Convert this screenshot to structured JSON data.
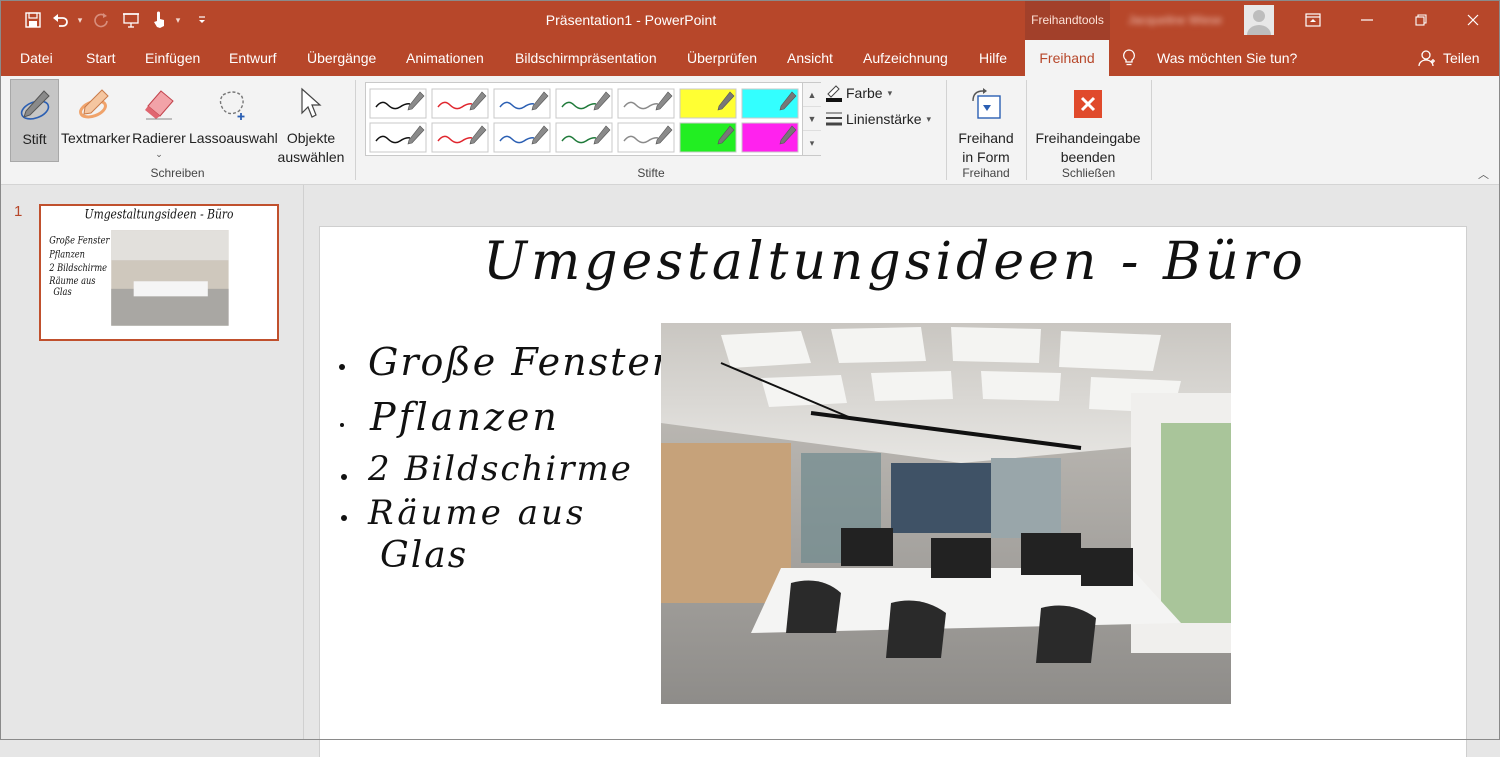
{
  "window": {
    "title": "Präsentation1  -  PowerPoint",
    "context_tab": "Freihandtools",
    "user_name": "Jacqueline Wiese"
  },
  "tabs": [
    {
      "label": "Datei"
    },
    {
      "label": "Start"
    },
    {
      "label": "Einfügen"
    },
    {
      "label": "Entwurf"
    },
    {
      "label": "Übergänge"
    },
    {
      "label": "Animationen"
    },
    {
      "label": "Bildschirmpräsentation"
    },
    {
      "label": "Überprüfen"
    },
    {
      "label": "Ansicht"
    },
    {
      "label": "Aufzeichnung"
    },
    {
      "label": "Hilfe"
    },
    {
      "label": "Freihand",
      "active": true
    }
  ],
  "tell_me": "Was möchten Sie tun?",
  "share": "Teilen",
  "ribbon": {
    "schreiben": {
      "label": "Schreiben",
      "stift": "Stift",
      "textmarker": "Textmarker",
      "radierer": "Radierer",
      "lasso": "Lassoauswahl",
      "objekte_1": "Objekte",
      "objekte_2": "auswählen"
    },
    "stifte": {
      "label": "Stifte",
      "farbe": "Farbe",
      "linienstaerke": "Linienstärke",
      "pens": [
        {
          "color": "#111111",
          "kind": "pen"
        },
        {
          "color": "#e0262e",
          "kind": "pen"
        },
        {
          "color": "#2b5fb3",
          "kind": "pen"
        },
        {
          "color": "#1f7a3a",
          "kind": "pen"
        },
        {
          "color": "#8a8a8a",
          "kind": "pen"
        },
        {
          "color": "#ffff33",
          "kind": "highlighter"
        },
        {
          "color": "#33ffff",
          "kind": "highlighter"
        },
        {
          "color": "#111111",
          "kind": "pen"
        },
        {
          "color": "#e0262e",
          "kind": "pen"
        },
        {
          "color": "#2b5fb3",
          "kind": "pen"
        },
        {
          "color": "#1f7a3a",
          "kind": "pen"
        },
        {
          "color": "#8a8a8a",
          "kind": "pen"
        },
        {
          "color": "#22ee22",
          "kind": "highlighter"
        },
        {
          "color": "#ff22ee",
          "kind": "highlighter"
        }
      ]
    },
    "freihand": {
      "label": "Freihand",
      "btn_1": "Freihand",
      "btn_2": "in Form"
    },
    "schliessen": {
      "label": "Schließen",
      "btn_1": "Freihandeingabe",
      "btn_2": "beenden"
    }
  },
  "thumbnails": [
    {
      "number": "1"
    }
  ],
  "slide": {
    "title_ink": "Umgestaltungsideen - Büro",
    "bullets": [
      "Große Fenster",
      "Pflanzen",
      "2 Bildschirme",
      "Räume aus",
      "Glas"
    ]
  },
  "colors": {
    "accent": "#b7472a",
    "selection": "#c0502d"
  }
}
